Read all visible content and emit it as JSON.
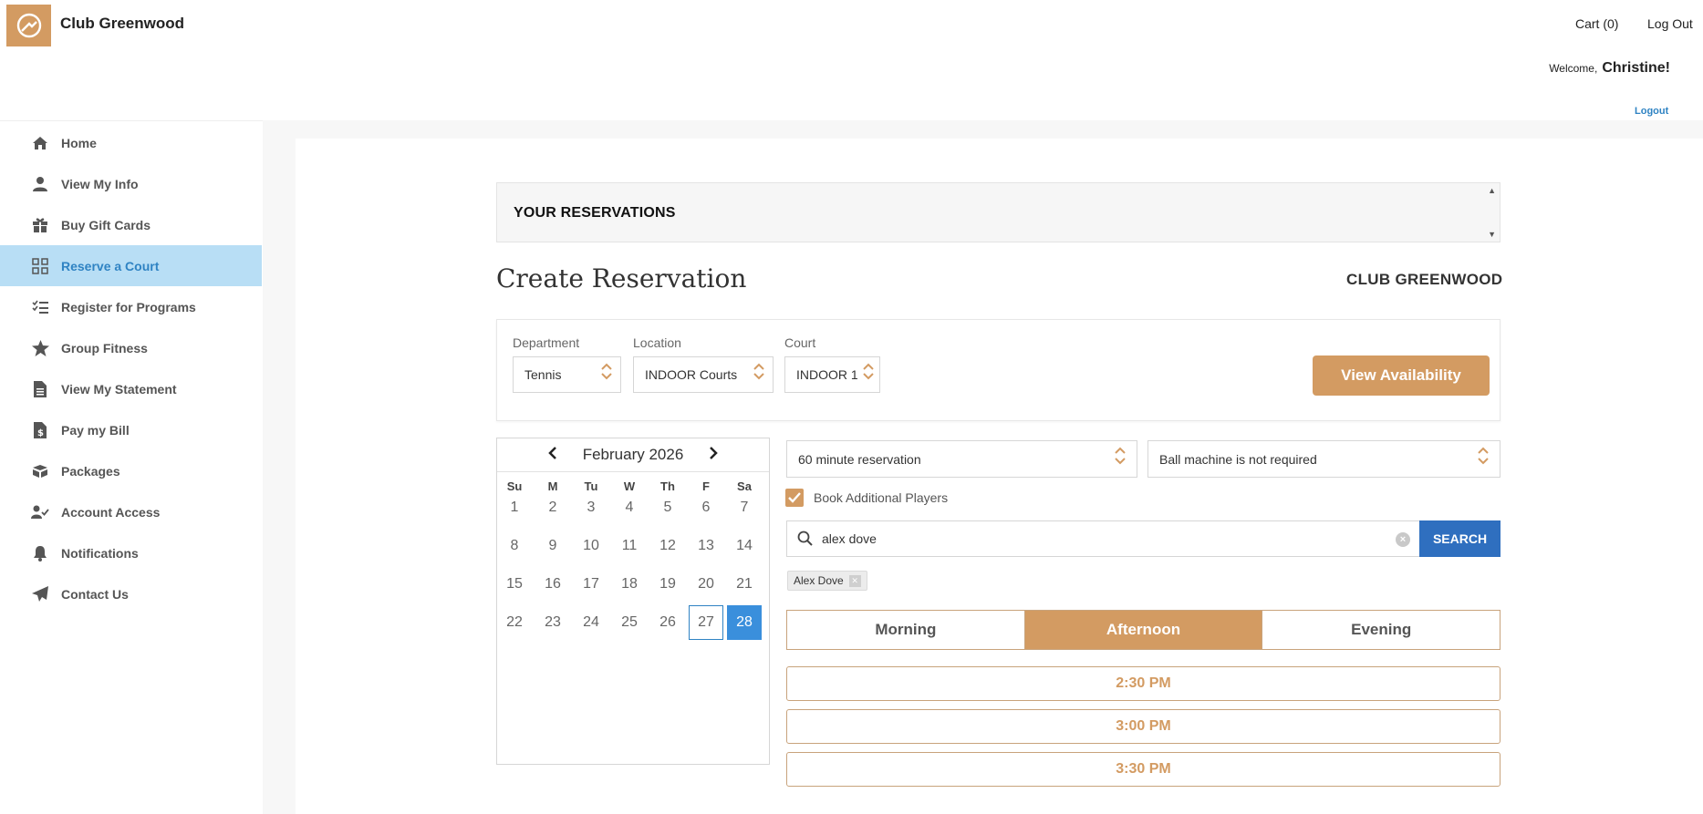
{
  "header": {
    "brand": "Club Greenwood",
    "cart_label": "Cart (0)",
    "logout_label": "Log Out",
    "welcome_label": "Welcome,",
    "user_name": "Christine!",
    "logout_small_label": "Logout"
  },
  "sidebar": {
    "items": [
      {
        "label": "Home",
        "icon": "home-icon"
      },
      {
        "label": "View My Info",
        "icon": "user-icon"
      },
      {
        "label": "Buy Gift Cards",
        "icon": "gift-icon"
      },
      {
        "label": "Reserve a Court",
        "icon": "grid-icon",
        "active": true
      },
      {
        "label": "Register for Programs",
        "icon": "checklist-icon"
      },
      {
        "label": "Group Fitness",
        "icon": "star-icon"
      },
      {
        "label": "View My Statement",
        "icon": "document-icon"
      },
      {
        "label": "Pay my Bill",
        "icon": "bill-icon"
      },
      {
        "label": "Packages",
        "icon": "box-icon"
      },
      {
        "label": "Account Access",
        "icon": "user-check-icon"
      },
      {
        "label": "Notifications",
        "icon": "bell-icon"
      },
      {
        "label": "Contact Us",
        "icon": "paper-plane-icon"
      }
    ]
  },
  "reservations": {
    "title": "YOUR RESERVATIONS"
  },
  "create": {
    "title": "Create Reservation",
    "club_name": "CLUB GREENWOOD"
  },
  "filters": {
    "department_label": "Department",
    "department_value": "Tennis",
    "location_label": "Location",
    "location_value": "INDOOR Courts",
    "court_label": "Court",
    "court_value": "INDOOR 1",
    "view_availability_label": "View Availability"
  },
  "calendar": {
    "month_label": "February 2026",
    "weekdays": [
      "Su",
      "M",
      "Tu",
      "W",
      "Th",
      "F",
      "Sa"
    ],
    "weeks": [
      [
        "1",
        "2",
        "3",
        "4",
        "5",
        "6",
        "7"
      ],
      [
        "8",
        "9",
        "10",
        "11",
        "12",
        "13",
        "14"
      ],
      [
        "15",
        "16",
        "17",
        "18",
        "19",
        "20",
        "21"
      ],
      [
        "22",
        "23",
        "24",
        "25",
        "26",
        "27",
        "28"
      ]
    ],
    "today": "27",
    "selected": "28"
  },
  "options": {
    "duration_value": "60 minute reservation",
    "ball_machine_value": "Ball machine is not required",
    "book_players_label": "Book Additional Players",
    "book_players_checked": true
  },
  "search": {
    "value": "alex dove",
    "button_label": "SEARCH"
  },
  "selected_players": [
    "Alex Dove"
  ],
  "periods": [
    {
      "label": "Morning"
    },
    {
      "label": "Afternoon",
      "active": true
    },
    {
      "label": "Evening"
    }
  ],
  "time_slots": [
    "2:30 PM",
    "3:00 PM",
    "3:30 PM"
  ],
  "colors": {
    "accent": "#d39b62",
    "active_nav_bg": "#b8def5",
    "link_blue": "#2f83c3",
    "search_button": "#2f6fbf",
    "selected_day": "#3a8fdc"
  }
}
